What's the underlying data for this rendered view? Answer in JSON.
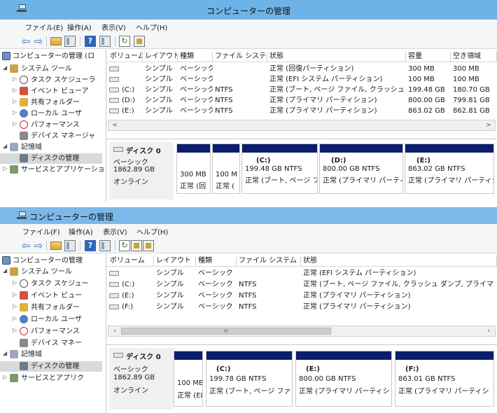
{
  "window1": {
    "title": "コンピューターの管理",
    "menu": [
      "ファイル(E)",
      "操作(A)",
      "表示(V)",
      "ヘルプ(H)"
    ],
    "tree": [
      {
        "label": "コンピューターの管理 (ロ",
        "icon": "computer-icon",
        "expander": ""
      },
      {
        "label": "システム ツール",
        "icon": "tools-icon",
        "expander": "◢"
      },
      {
        "label": "タスク スケジューラ",
        "icon": "clock-icon",
        "expander": "▷"
      },
      {
        "label": "イベント ビューア",
        "icon": "event-viewer-icon",
        "expander": "▷"
      },
      {
        "label": "共有フォルダー",
        "icon": "shared-folder-icon",
        "expander": "▷"
      },
      {
        "label": "ローカル ユーザ",
        "icon": "users-icon",
        "expander": "▷"
      },
      {
        "label": "パフォーマンス",
        "icon": "performance-icon",
        "expander": "▷"
      },
      {
        "label": "デバイス マネージャ",
        "icon": "device-manager-icon",
        "expander": ""
      },
      {
        "label": "記憶域",
        "icon": "storage-icon",
        "expander": "◢"
      },
      {
        "label": "ディスクの管理",
        "icon": "disk-management-icon",
        "expander": ""
      },
      {
        "label": "サービスとアプリケーション",
        "icon": "services-icon",
        "expander": "▷"
      }
    ],
    "columns": [
      "ボリューム",
      "レイアウト",
      "種類",
      "ファイル システム",
      "状態",
      "容量",
      "空き領域"
    ],
    "rows": [
      [
        "",
        "シンプル",
        "ベーシック",
        "",
        "正常 (回復パーティション)",
        "300 MB",
        "300 MB"
      ],
      [
        "",
        "シンプル",
        "ベーシック",
        "",
        "正常 (EFI システム パーティション)",
        "100 MB",
        "100 MB"
      ],
      [
        "(C:)",
        "シンプル",
        "ベーシック",
        "NTFS",
        "正常 (ブート, ページ ファイル, クラッシュ ダ...",
        "199.48 GB",
        "180.70 GB"
      ],
      [
        "(D:)",
        "シンプル",
        "ベーシック",
        "NTFS",
        "正常 (プライマリ パーティション)",
        "800.00 GB",
        "799.81 GB"
      ],
      [
        "(E:)",
        "シンプル",
        "ベーシック",
        "NTFS",
        "正常 (プライマリ パーティション)",
        "863.02 GB",
        "862.81 GB"
      ]
    ],
    "scroll": {
      "left": "<",
      "right": ">",
      "thumb": ""
    },
    "disk": {
      "name": "ディスク 0",
      "type": "ベーシック",
      "size": "1862.89 GB",
      "status": "オンライン"
    },
    "partitions": [
      {
        "name": "",
        "line1": "300 MB",
        "line2": "正常 (回"
      },
      {
        "name": "",
        "line1": "100 M",
        "line2": "正常 ("
      },
      {
        "name": "(C:)",
        "line1": "199.48 GB NTFS",
        "line2": "正常 (ブート, ページ フ"
      },
      {
        "name": "(D:)",
        "line1": "800.00 GB NTFS",
        "line2": "正常 (プライマリ パーティシ"
      },
      {
        "name": "(E:)",
        "line1": "863.02 GB NTFS",
        "line2": "正常 (プライマリ パーティシ"
      }
    ]
  },
  "window2": {
    "title": "コンピューターの管理",
    "menu": [
      "ファイル(F)",
      "操作(A)",
      "表示(V)",
      "ヘルプ(H)"
    ],
    "tree": [
      {
        "label": "コンピューターの管理",
        "icon": "computer-icon",
        "expander": ""
      },
      {
        "label": "システム ツール",
        "icon": "tools-icon",
        "expander": "◢"
      },
      {
        "label": "タスク スケジュー",
        "icon": "clock-icon",
        "expander": "▷"
      },
      {
        "label": "イベント ビュー",
        "icon": "event-viewer-icon",
        "expander": "▷"
      },
      {
        "label": "共有フォルダー",
        "icon": "shared-folder-icon",
        "expander": "▷"
      },
      {
        "label": "ローカル ユーザ",
        "icon": "users-icon",
        "expander": "▷"
      },
      {
        "label": "パフォーマンス",
        "icon": "performance-icon",
        "expander": "▷"
      },
      {
        "label": "デバイス マネー",
        "icon": "device-manager-icon",
        "expander": ""
      },
      {
        "label": "記憶域",
        "icon": "storage-icon",
        "expander": "◢"
      },
      {
        "label": "ディスクの管理",
        "icon": "disk-management-icon",
        "expander": ""
      },
      {
        "label": "サービスとアプリク",
        "icon": "services-icon",
        "expander": "▷"
      }
    ],
    "columns": [
      "ボリューム",
      "レイアウト",
      "種類",
      "ファイル システム",
      "状態"
    ],
    "rows": [
      [
        "",
        "シンプル",
        "ベーシック",
        "",
        "正常 (EFI システム パーティション)"
      ],
      [
        "(C:)",
        "シンプル",
        "ベーシック",
        "NTFS",
        "正常 (ブート, ページ ファイル, クラッシュ ダンプ, プライマ"
      ],
      [
        "(E:)",
        "シンプル",
        "ベーシック",
        "NTFS",
        "正常 (プライマリ パーティション)"
      ],
      [
        "(F:)",
        "シンプル",
        "ベーシック",
        "NTFS",
        "正常 (プライマリ パーティション)"
      ]
    ],
    "scroll": {
      "left": "‹",
      "right": "›",
      "thumb": "III"
    },
    "disk": {
      "name": "ディスク 0",
      "type": "ベーシック",
      "size": "1862.89 GB",
      "status": "オンライン"
    },
    "partitions": [
      {
        "name": "",
        "line1": "100 MB",
        "line2": "正常 (EI"
      },
      {
        "name": "(C:)",
        "line1": "199.78 GB NTFS",
        "line2": "正常 (ブート, ページ ファ"
      },
      {
        "name": "(E:)",
        "line1": "800.00 GB NTFS",
        "line2": "正常 (プライマリ パーティシ"
      },
      {
        "name": "(F:)",
        "line1": "863.01 GB NTFS",
        "line2": "正常 (プライマリ パーティシ"
      }
    ]
  }
}
